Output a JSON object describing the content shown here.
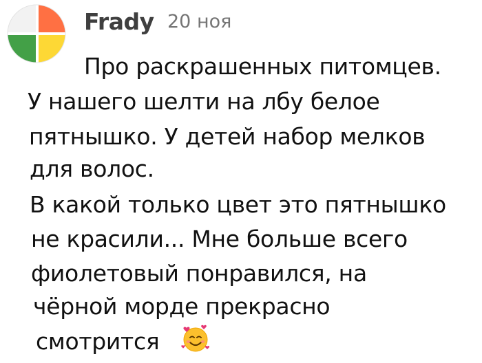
{
  "comment": {
    "author": "Frady",
    "date": "20 ноя",
    "avatar_icon": "colorful-quadrant-avatar",
    "avatar_colors": {
      "top_right": "#ff7043",
      "bottom_right": "#fdd835",
      "bottom_left": "#43a047",
      "top_left": "#f0f0f0"
    },
    "lines": [
      "Про раскрашенных питомцев.",
      "У нашего шелти на лбу белое",
      "пятнышко. У детей набор мелков",
      "для волос.",
      "В какой только цвет это пятнышко",
      "не красили... Мне больше всего",
      "фиолетовый понравился, на",
      "чёрной морде прекрасно",
      "смотрится"
    ],
    "emoji": "smiling-face-with-hearts-icon"
  }
}
